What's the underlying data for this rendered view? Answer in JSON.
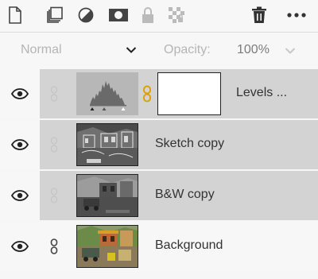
{
  "toolbar": {
    "icons": [
      "new-layer-icon",
      "duplicate-layer-icon",
      "adjustment-layer-icon",
      "layer-mask-icon",
      "lock-icon",
      "transparency-lock-icon",
      "trash-icon",
      "more-icon"
    ]
  },
  "blend": {
    "mode": "Normal",
    "opacity_label": "Opacity:",
    "opacity_value": "100%"
  },
  "layers": [
    {
      "name": "Levels ...",
      "visible": true,
      "selected": true,
      "type": "adjustment",
      "has_mask": true
    },
    {
      "name": "Sketch copy",
      "visible": true,
      "selected": true,
      "type": "image"
    },
    {
      "name": "B&W copy",
      "visible": true,
      "selected": true,
      "type": "image"
    },
    {
      "name": "Background",
      "visible": true,
      "selected": false,
      "type": "image"
    }
  ],
  "colors": {
    "selected_row": "#d3d3d3",
    "link_accent": "#e0a100"
  }
}
